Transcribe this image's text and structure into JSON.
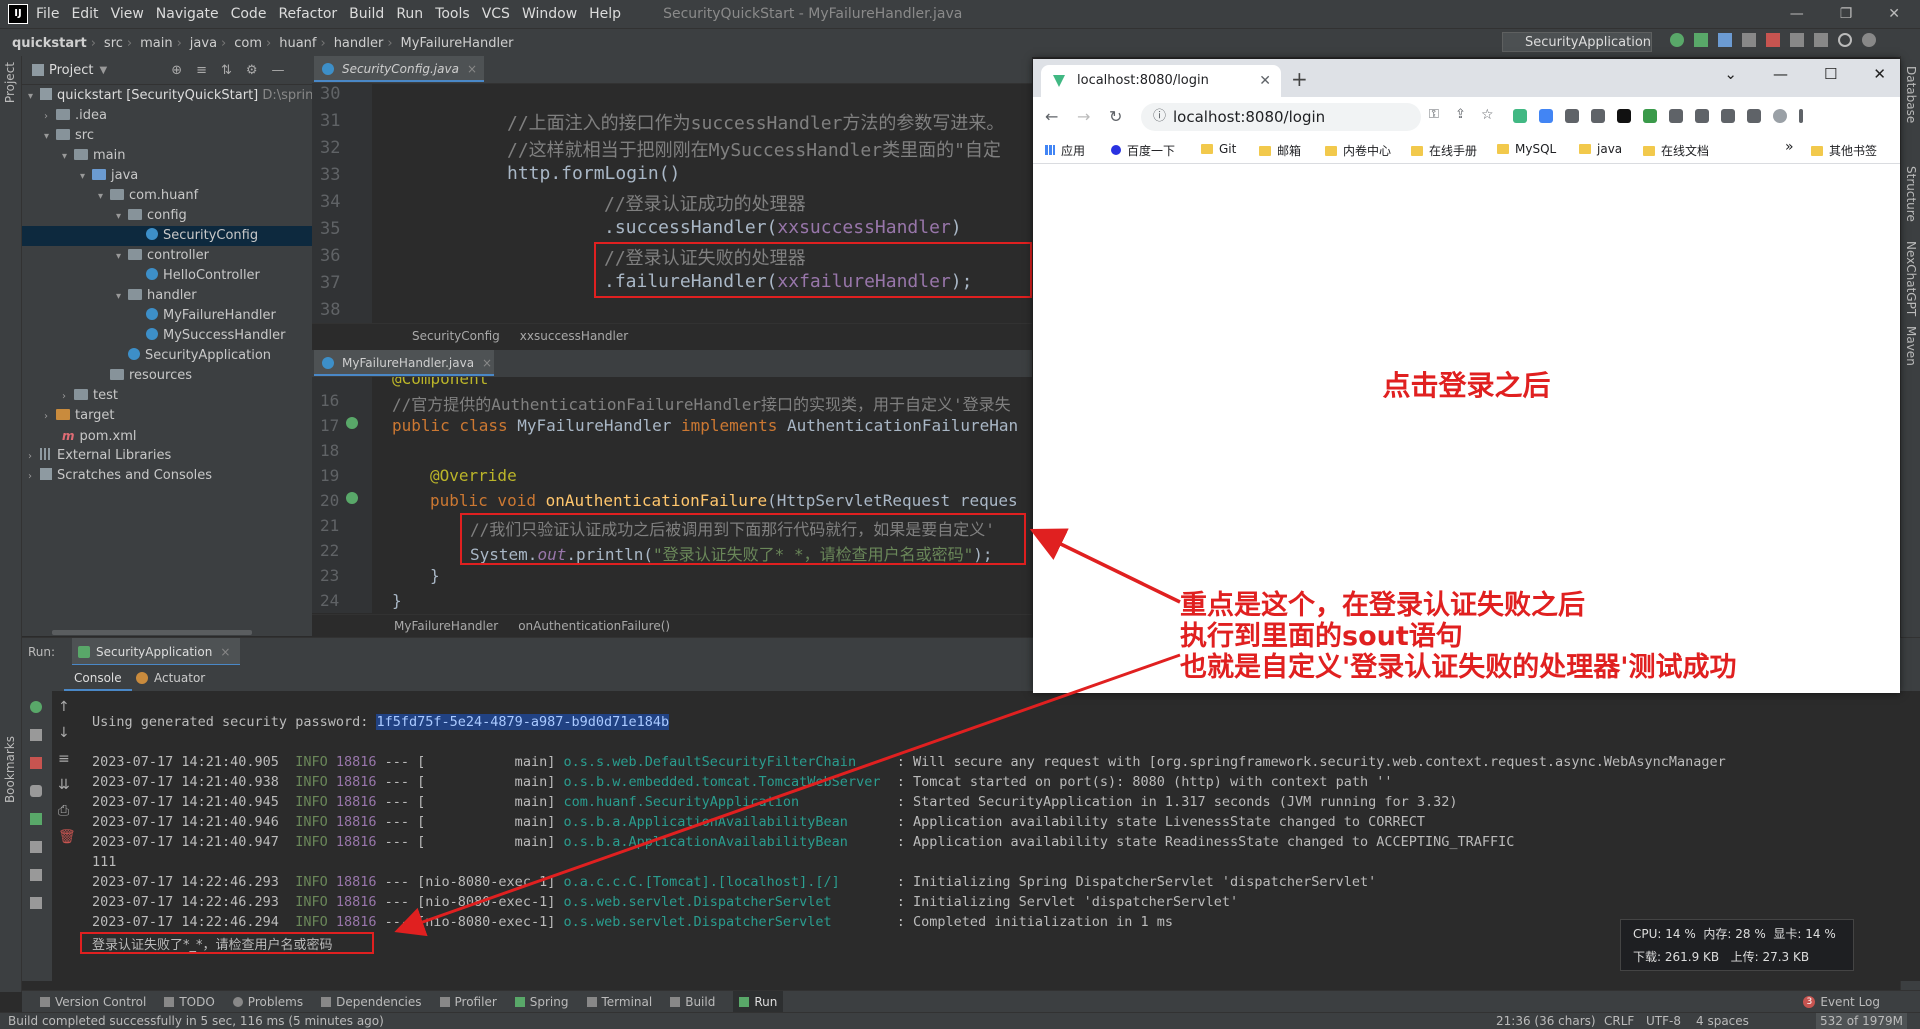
{
  "window": {
    "menus": [
      "File",
      "Edit",
      "View",
      "Navigate",
      "Code",
      "Refactor",
      "Build",
      "Run",
      "Tools",
      "VCS",
      "Window",
      "Help"
    ],
    "title": "SecurityQuickStart - MyFailureHandler.java"
  },
  "navbar": {
    "crumbs": [
      "quickstart",
      "src",
      "main",
      "java",
      "com",
      "huanf",
      "handler",
      "MyFailureHandler"
    ],
    "run_config": "SecurityApplication"
  },
  "left_stripe": {
    "project": "Project",
    "bookmarks": "Bookmarks"
  },
  "right_stripe": [
    "Database",
    "Structure",
    "NexChatGPT",
    "Maven"
  ],
  "project": {
    "header": "Project",
    "items": [
      {
        "label": "quickstart [SecurityQuickStart]",
        "extra": "D:\\springs"
      },
      {
        "label": ".idea"
      },
      {
        "label": "src"
      },
      {
        "label": "main"
      },
      {
        "label": "java"
      },
      {
        "label": "com.huanf"
      },
      {
        "label": "config"
      },
      {
        "label": "SecurityConfig"
      },
      {
        "label": "controller"
      },
      {
        "label": "HelloController"
      },
      {
        "label": "handler"
      },
      {
        "label": "MyFailureHandler"
      },
      {
        "label": "MySuccessHandler"
      },
      {
        "label": "SecurityApplication"
      },
      {
        "label": "resources"
      },
      {
        "label": "test"
      },
      {
        "label": "target"
      },
      {
        "label": "pom.xml"
      },
      {
        "label": "External Libraries"
      },
      {
        "label": "Scratches and Consoles"
      }
    ]
  },
  "editor1": {
    "tab": "SecurityConfig.java",
    "lines": [
      "30",
      "31",
      "32",
      "33",
      "34",
      "35",
      "36",
      "37",
      "38"
    ],
    "code": {
      "l31": "//上面注入的接口作为successHandler方法的参数写进来。",
      "l32": "//这样就相当于把刚刚在MySuccessHandler类里面的\"自定",
      "l33": "http.formLogin()",
      "l34": "//登录认证成功的处理器",
      "l35a": ".successHandler(",
      "l35b": "xxsuccessHandler",
      "l35c": ")",
      "l36": "//登录认证失败的处理器",
      "l37a": ".failureHandler(",
      "l37b": "xxfailureHandler",
      "l37c": ");"
    },
    "crumbs": [
      "SecurityConfig",
      "xxsuccessHandler"
    ]
  },
  "editor2": {
    "tab": "MyFailureHandler.java",
    "lines": [
      "16",
      "17",
      "18",
      "19",
      "20",
      "21",
      "22",
      "23",
      "24"
    ],
    "code": {
      "l15": "@Component",
      "l16": "//官方提供的AuthenticationFailureHandler接口的实现类，用于自定义'登录失",
      "l17a": "public class ",
      "l17b": "MyFailureHandler ",
      "l17c": "implements ",
      "l17d": "AuthenticationFailureHan",
      "l19": "@Override",
      "l20a": "public void ",
      "l20b": "onAuthenticationFailure",
      "l20c": "(HttpServletRequest reques",
      "l21": "//我们只验证认证成功之后被调用到下面那行代码就行，如果是要自定义'",
      "l22a": "System.",
      "l22b": "out",
      "l22c": ".println(",
      "l22d": "\"登录认证失败了*_*，请检查用户名或密码\"",
      "l22e": ");",
      "l23": "}",
      "l24": "}"
    },
    "crumbs": [
      "MyFailureHandler",
      "onAuthenticationFailure()"
    ]
  },
  "run": {
    "label": "Run:",
    "config_tab": "SecurityApplication",
    "tabs": [
      "Console",
      "Actuator"
    ],
    "password_prefix": "Using generated security password: ",
    "password": "1f5fd75f-5e24-4879-a987-b9d0d71e184b",
    "logs": [
      {
        "time": "2023-07-17 14:21:40.905",
        "level": "INFO",
        "pid": "18816",
        "sep": "--- [",
        "thread": "           main]",
        "logger": "o.s.s.web.DefaultSecurityFilterChain    ",
        "msg": ": Will secure any request with [org.springframework.security.web.context.request.async.WebAsyncManager"
      },
      {
        "time": "2023-07-17 14:21:40.938",
        "level": "INFO",
        "pid": "18816",
        "sep": "--- [",
        "thread": "           main]",
        "logger": "o.s.b.w.embedded.tomcat.TomcatWebServer ",
        "msg": ": Tomcat started on port(s): 8080 (http) with context path ''"
      },
      {
        "time": "2023-07-17 14:21:40.945",
        "level": "INFO",
        "pid": "18816",
        "sep": "--- [",
        "thread": "           main]",
        "logger": "com.huanf.SecurityApplication           ",
        "msg": ": Started SecurityApplication in 1.317 seconds (JVM running for 3.32)"
      },
      {
        "time": "2023-07-17 14:21:40.946",
        "level": "INFO",
        "pid": "18816",
        "sep": "--- [",
        "thread": "           main]",
        "logger": "o.s.b.a.ApplicationAvailabilityBean     ",
        "msg": ": Application availability state LivenessState changed to CORRECT"
      },
      {
        "time": "2023-07-17 14:21:40.947",
        "level": "INFO",
        "pid": "18816",
        "sep": "--- [",
        "thread": "           main]",
        "logger": "o.s.b.a.ApplicationAvailabilityBean     ",
        "msg": ": Application availability state ReadinessState changed to ACCEPTING_TRAFFIC"
      }
    ],
    "line_111": "111",
    "logs2": [
      {
        "time": "2023-07-17 14:22:46.293",
        "level": "INFO",
        "pid": "18816",
        "sep": "--- [",
        "thread": "nio-8080-exec-1]",
        "logger": "o.a.c.c.C.[Tomcat].[localhost].[/]      ",
        "msg": ": Initializing Spring DispatcherServlet 'dispatcherServlet'"
      },
      {
        "time": "2023-07-17 14:22:46.293",
        "level": "INFO",
        "pid": "18816",
        "sep": "--- [",
        "thread": "nio-8080-exec-1]",
        "logger": "o.s.web.servlet.DispatcherServlet       ",
        "msg": ": Initializing Servlet 'dispatcherServlet'"
      },
      {
        "time": "2023-07-17 14:22:46.294",
        "level": "INFO",
        "pid": "18816",
        "sep": "--- [",
        "thread": "nio-8080-exec-1]",
        "logger": "o.s.web.servlet.DispatcherServlet       ",
        "msg": ": Completed initialization in 1 ms"
      }
    ],
    "failure_output": "登录认证失败了*_*，请检查用户名或密码"
  },
  "bottom_tools": [
    "Version Control",
    "TODO",
    "Problems",
    "Dependencies",
    "Profiler",
    "Spring",
    "Terminal",
    "Build",
    "Run"
  ],
  "event_log": "Event Log",
  "event_count": "3",
  "status": {
    "left": "Build completed successfully in 5 sec, 116 ms (5 minutes ago)",
    "pos": "21:36 (36 chars)",
    "eol": "CRLF",
    "enc": "UTF-8",
    "indent": "4 spaces",
    "mem": "532 of 1979M"
  },
  "perf": {
    "cpu": "CPU: 14 %",
    "memory": "内存: 28 %",
    "gpu": "显卡: 14 %",
    "down": "下载: 261.9 KB",
    "up": "上传: 27.3 KB"
  },
  "browser": {
    "tab_title": "localhost:8080/login",
    "url": "localhost:8080/login",
    "bookmarks": [
      "应用",
      "百度一下",
      "Git",
      "邮箱",
      "内卷中心",
      "在线手册",
      "MySQL",
      "java",
      "在线文档"
    ],
    "bookmarks_more": "»",
    "other_bookmarks": "其他书签",
    "page_note": "点击登录之后"
  },
  "annotation": {
    "line1": "重点是这个，在登录认证失败之后",
    "line2": "执行到里面的sout语句",
    "line3": "也就是自定义'登录认证失败的处理器'测试成功"
  },
  "colors": {
    "ide_bg": "#2b2b2b",
    "panel_bg": "#3c3f41",
    "annotation_red": "#e02020",
    "selection": "#0d293e"
  }
}
